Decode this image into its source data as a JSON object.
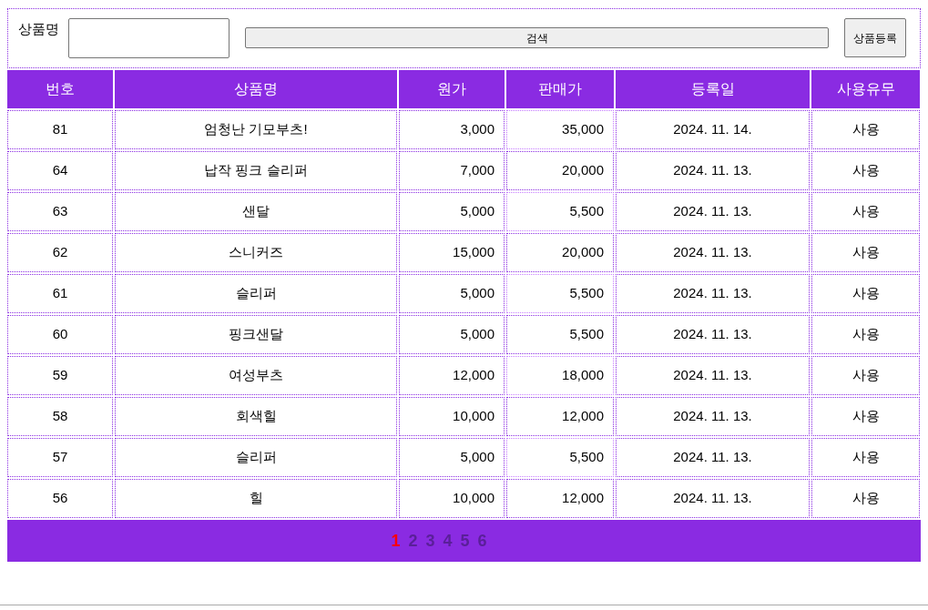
{
  "search": {
    "label": "상품명",
    "search_button": "검색",
    "register_button": "상품등록"
  },
  "table": {
    "columns": [
      "번호",
      "상품명",
      "원가",
      "판매가",
      "등록일",
      "사용유무"
    ],
    "rows": [
      [
        "81",
        "엄청난 기모부츠!",
        "3,000",
        "35,000",
        "2024. 11. 14.",
        "사용"
      ],
      [
        "64",
        "납작 핑크 슬리퍼",
        "7,000",
        "20,000",
        "2024. 11. 13.",
        "사용"
      ],
      [
        "63",
        "샌달",
        "5,000",
        "5,500",
        "2024. 11. 13.",
        "사용"
      ],
      [
        "62",
        "스니커즈",
        "15,000",
        "20,000",
        "2024. 11. 13.",
        "사용"
      ],
      [
        "61",
        "슬리퍼",
        "5,000",
        "5,500",
        "2024. 11. 13.",
        "사용"
      ],
      [
        "60",
        "핑크샌달",
        "5,000",
        "5,500",
        "2024. 11. 13.",
        "사용"
      ],
      [
        "59",
        "여성부츠",
        "12,000",
        "18,000",
        "2024. 11. 13.",
        "사용"
      ],
      [
        "58",
        "회색힐",
        "10,000",
        "12,000",
        "2024. 11. 13.",
        "사용"
      ],
      [
        "57",
        "슬리퍼",
        "5,000",
        "5,500",
        "2024. 11. 13.",
        "사용"
      ],
      [
        "56",
        "힐",
        "10,000",
        "12,000",
        "2024. 11. 13.",
        "사용"
      ]
    ]
  },
  "pagination": [
    {
      "label": "1",
      "selected": true
    },
    {
      "label": "2",
      "selected": false
    },
    {
      "label": "3",
      "selected": false
    },
    {
      "label": "4",
      "selected": false
    },
    {
      "label": "5",
      "selected": false
    },
    {
      "label": "6",
      "selected": false
    }
  ]
}
